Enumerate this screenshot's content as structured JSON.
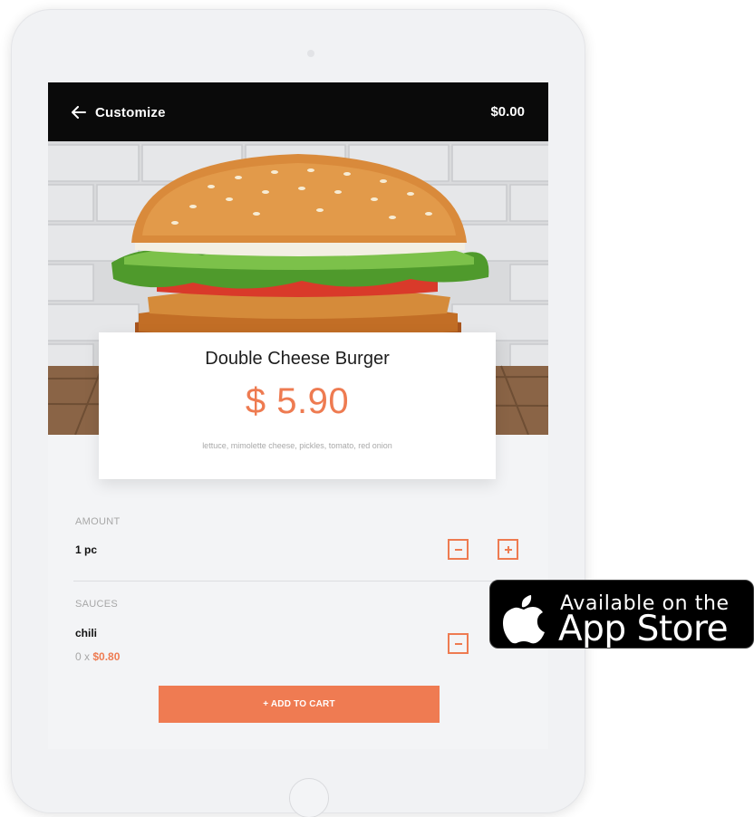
{
  "header": {
    "title": "Customize",
    "cart_total": "$0.00"
  },
  "product": {
    "name": "Double Cheese Burger",
    "price": "$ 5.90",
    "description": "lettuce, mimolette cheese, pickles, tomato, red onion"
  },
  "amount": {
    "label": "AMOUNT",
    "value": "1 pc"
  },
  "sauces": {
    "label": "SAUCES",
    "item_name": "chili",
    "quantity_prefix": "0 x ",
    "unit_price": "$0.80"
  },
  "actions": {
    "add_to_cart": "+ ADD TO CART"
  },
  "badge": {
    "line1": "Available on the",
    "line2": "App Store"
  },
  "colors": {
    "accent": "#ee7b51",
    "topbar": "#0a0a0a",
    "screen_bg": "#f3f4f6"
  },
  "icons": {
    "back": "arrow-left-icon",
    "minus": "minus-icon",
    "plus": "plus-icon",
    "apple": "apple-logo-icon"
  }
}
